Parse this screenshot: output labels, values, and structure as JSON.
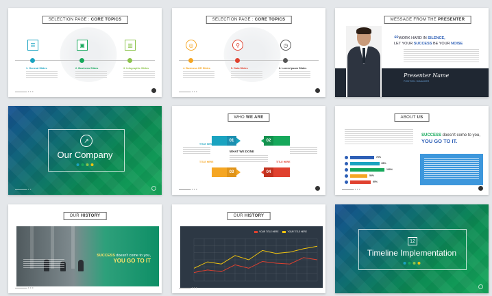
{
  "colors": {
    "green": "#16a85b",
    "blue": "#2d5fb6",
    "orange": "#f5a623",
    "red": "#e0412f",
    "teal": "#1aa3c0",
    "gold": "#f1c40f"
  },
  "slides": {
    "s1": {
      "title_light": "SELECTION PAGE : ",
      "title_bold": "CORE TOPICS",
      "items": [
        {
          "label": "1. General Slides",
          "icon": "list-icon"
        },
        {
          "label": "2. Business Slides",
          "icon": "briefcase-icon"
        },
        {
          "label": "3. Infographic Slides",
          "icon": "chart-icon"
        }
      ]
    },
    "s2": {
      "title_light": "SELECTION PAGE : ",
      "title_bold": "CORE TOPICS",
      "items": [
        {
          "label": "4. Business HR Slides",
          "icon": "globe-icon"
        },
        {
          "label": "5. Data Slides",
          "icon": "pin-icon"
        },
        {
          "label": "6. Lorem Ipsum Slides",
          "icon": "clock-icon"
        }
      ]
    },
    "s3": {
      "title_light": "MESSAGE FROM THE ",
      "title_bold": "PRESENTER",
      "quote_a": "WORK HARD IN ",
      "quote_b": "SILENCE,",
      "quote_c": "LET YOUR ",
      "quote_d": "SUCCESS",
      "quote_e": " BE YOUR ",
      "quote_f": "NOISE",
      "signature": "Presenter Name",
      "role": "POSITION / MANAGER"
    },
    "s4": {
      "title": "Our Company"
    },
    "s5": {
      "title_light": "WHO ",
      "title_bold": "WE ARE",
      "center": "WHAT WE DONE",
      "nums": [
        "01",
        "02",
        "03",
        "04"
      ],
      "item_title": "TITLE HERE"
    },
    "s6": {
      "title_light": "ABOUT ",
      "title_bold": "US",
      "bars": [
        {
          "pct": "70%",
          "value": 70
        },
        {
          "pct": "85%",
          "value": 85
        },
        {
          "pct": "100%",
          "value": 100
        },
        {
          "pct": "50%",
          "value": 50
        },
        {
          "pct": "60%",
          "value": 60
        }
      ],
      "head_a": "SUCCESS",
      "head_b": " doesn't come to you,",
      "head_c": "YOU GO TO IT."
    },
    "s7": {
      "title_light": "OUR ",
      "title_bold": "HISTORY",
      "text_a": "SUCCESS",
      "text_b": " doesn't come to you,",
      "text_c": "YOU GO TO IT"
    },
    "s8": {
      "title_light": "OUR ",
      "title_bold": "HISTORY",
      "legend": [
        "YOUR TITLE HERE",
        "YOUR TITLE HERE"
      ],
      "chart_data": {
        "type": "line",
        "series": [
          {
            "values": [
              30,
              45,
              40,
              60,
              50,
              72,
              65,
              68,
              76,
              82
            ]
          },
          {
            "values": [
              20,
              26,
              22,
              38,
              30,
              46,
              42,
              40,
              55,
              50
            ]
          }
        ]
      }
    },
    "s9": {
      "title_a": "Timeline ",
      "title_b": "Implementation"
    }
  }
}
